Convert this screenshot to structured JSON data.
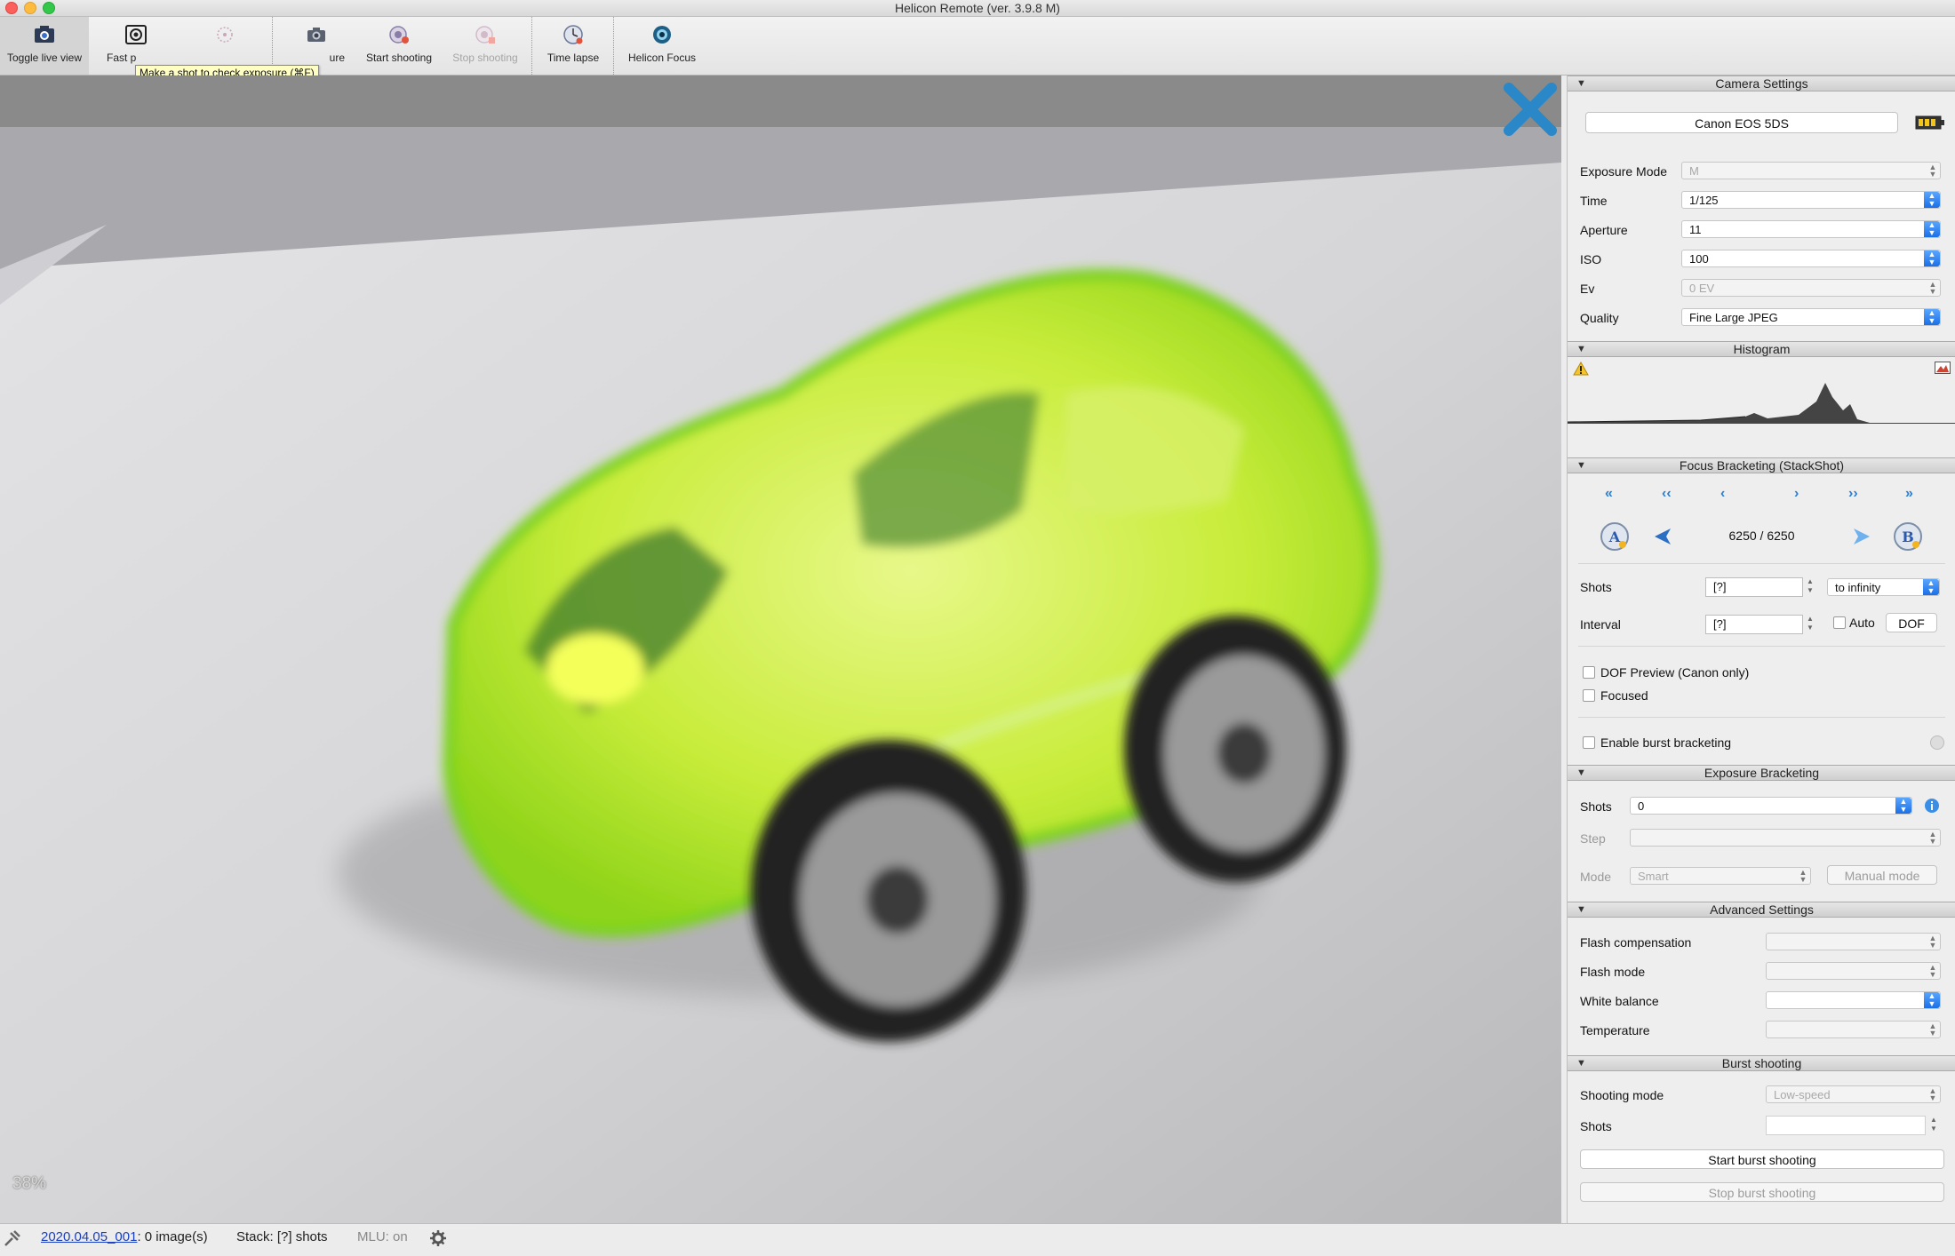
{
  "window": {
    "title": "Helicon Remote (ver. 3.9.8 M)"
  },
  "toolbar": {
    "buttons": [
      {
        "label": "Toggle live view",
        "icon": "live-view-camera-icon"
      },
      {
        "label": "Fast p",
        "icon": "fast-preview-icon"
      },
      {
        "label": "",
        "icon": "autofocus-icon"
      },
      {
        "label": "ure",
        "icon": "capture-camera-icon"
      },
      {
        "label": "Start shooting",
        "icon": "start-shooting-icon"
      },
      {
        "label": "Stop shooting",
        "icon": "stop-shooting-icon"
      },
      {
        "label": "Time lapse",
        "icon": "time-lapse-icon"
      },
      {
        "label": "Helicon Focus",
        "icon": "helicon-focus-icon"
      }
    ],
    "tooltip": "Make a shot to check exposure (⌘F)"
  },
  "viewer": {
    "zoom": "38%"
  },
  "camera_settings": {
    "title": "Camera Settings",
    "camera_name": "Canon EOS 5DS",
    "fields": [
      {
        "label": "Exposure Mode",
        "value": "M"
      },
      {
        "label": "Time",
        "value": "1/125"
      },
      {
        "label": "Aperture",
        "value": "11"
      },
      {
        "label": "ISO",
        "value": "100"
      },
      {
        "label": "Ev",
        "value": "0 EV"
      },
      {
        "label": "Quality",
        "value": "Fine Large JPEG"
      }
    ]
  },
  "histogram": {
    "title": "Histogram"
  },
  "focus_bracketing": {
    "title": "Focus Bracketing (StackShot)",
    "position": "6250 / 6250",
    "shots_label": "Shots",
    "shots_value": "[?]",
    "direction": "to infinity",
    "interval_label": "Interval",
    "interval_value": "[?]",
    "auto_label": "Auto",
    "dof_button": "DOF",
    "dof_preview": "DOF Preview (Canon only)",
    "focused": "Focused",
    "burst": "Enable burst bracketing"
  },
  "exposure_bracketing": {
    "title": "Exposure Bracketing",
    "shots_label": "Shots",
    "shots_value": "0",
    "step_label": "Step",
    "mode_label": "Mode",
    "mode_value": "Smart",
    "manual_button": "Manual mode"
  },
  "advanced": {
    "title": "Advanced Settings",
    "flash_comp": "Flash compensation",
    "flash_mode": "Flash mode",
    "white_balance": "White balance",
    "temperature": "Temperature"
  },
  "burst": {
    "title": "Burst shooting",
    "mode_label": "Shooting mode",
    "mode_value": "Low-speed",
    "shots_label": "Shots",
    "start_button": "Start burst shooting",
    "stop_button": "Stop burst shooting"
  },
  "status": {
    "session_link": "2020.04.05_001",
    "images": ": 0 image(s)",
    "stack": "Stack: [?] shots",
    "mlu": "MLU: on"
  }
}
